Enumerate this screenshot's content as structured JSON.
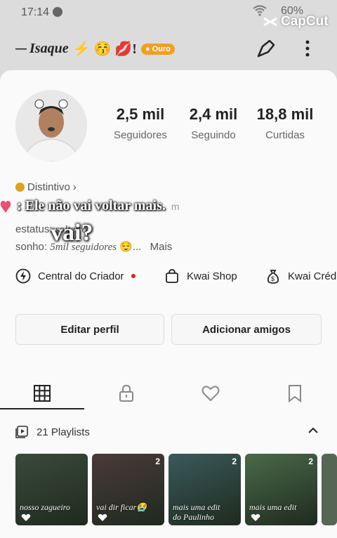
{
  "status_bar": {
    "time": "17:14",
    "battery": "60%"
  },
  "watermark": "CapCut",
  "profile": {
    "username": "Isaque",
    "username_prefix": "—",
    "username_suffix_emojis": "⚡ 😚 💋!",
    "badge": "Ouro",
    "stats": [
      {
        "value": "2,5 mil",
        "label": "Seguidores"
      },
      {
        "value": "2,4 mil",
        "label": "Seguindo"
      },
      {
        "value": "18,8 mil",
        "label": "Curtidas"
      }
    ],
    "distintivo": "Distintivo",
    "distintivo_chevron": "›",
    "bio_status_label": "estatus:",
    "bio_status_value": "solteiro",
    "bio_dream_label": "sonho:",
    "bio_dream_value": "5mil seguidores",
    "bio_dream_suffix": "😌...",
    "more_label": "Mais"
  },
  "overlay": {
    "lyric_line": ": Ele não vai voltar mais.",
    "lyric_ghost_tail": "m",
    "lyric_big": "vai?"
  },
  "tools": [
    {
      "label": "Central do Criador",
      "icon": "bolt-circle-icon"
    },
    {
      "label": "Kwai Shop",
      "icon": "shopping-bag-icon"
    },
    {
      "label": "Kwai Créd",
      "icon": "money-bag-icon"
    }
  ],
  "actions": {
    "edit_profile": "Editar perfil",
    "add_friends": "Adicionar amigos"
  },
  "tabs": [
    {
      "name": "grid",
      "icon": "grid-icon",
      "active": true
    },
    {
      "name": "private",
      "icon": "lock-icon",
      "active": false
    },
    {
      "name": "liked",
      "icon": "heart-icon",
      "active": false
    },
    {
      "name": "saved",
      "icon": "bookmark-icon",
      "active": false
    }
  ],
  "playlists": {
    "title": "21 Playlists",
    "items": [
      {
        "caption": "nosso zagueiro",
        "caption2": "",
        "count": "",
        "color": "#3a4a3a"
      },
      {
        "caption": "vai dir ficar😭",
        "caption2": "",
        "count": "2",
        "color": "#4a3a3a"
      },
      {
        "caption": "mais uma edit",
        "caption2": "do Paulinho",
        "count": "2",
        "color": "#3a5a5a"
      },
      {
        "caption": "mais uma edit",
        "caption2": "",
        "count": "2",
        "color": "#4a6a4a"
      }
    ]
  },
  "colors": {
    "accent": "#f0a020",
    "live_dot": "#e02020",
    "text": "#222222",
    "muted": "#666666"
  }
}
